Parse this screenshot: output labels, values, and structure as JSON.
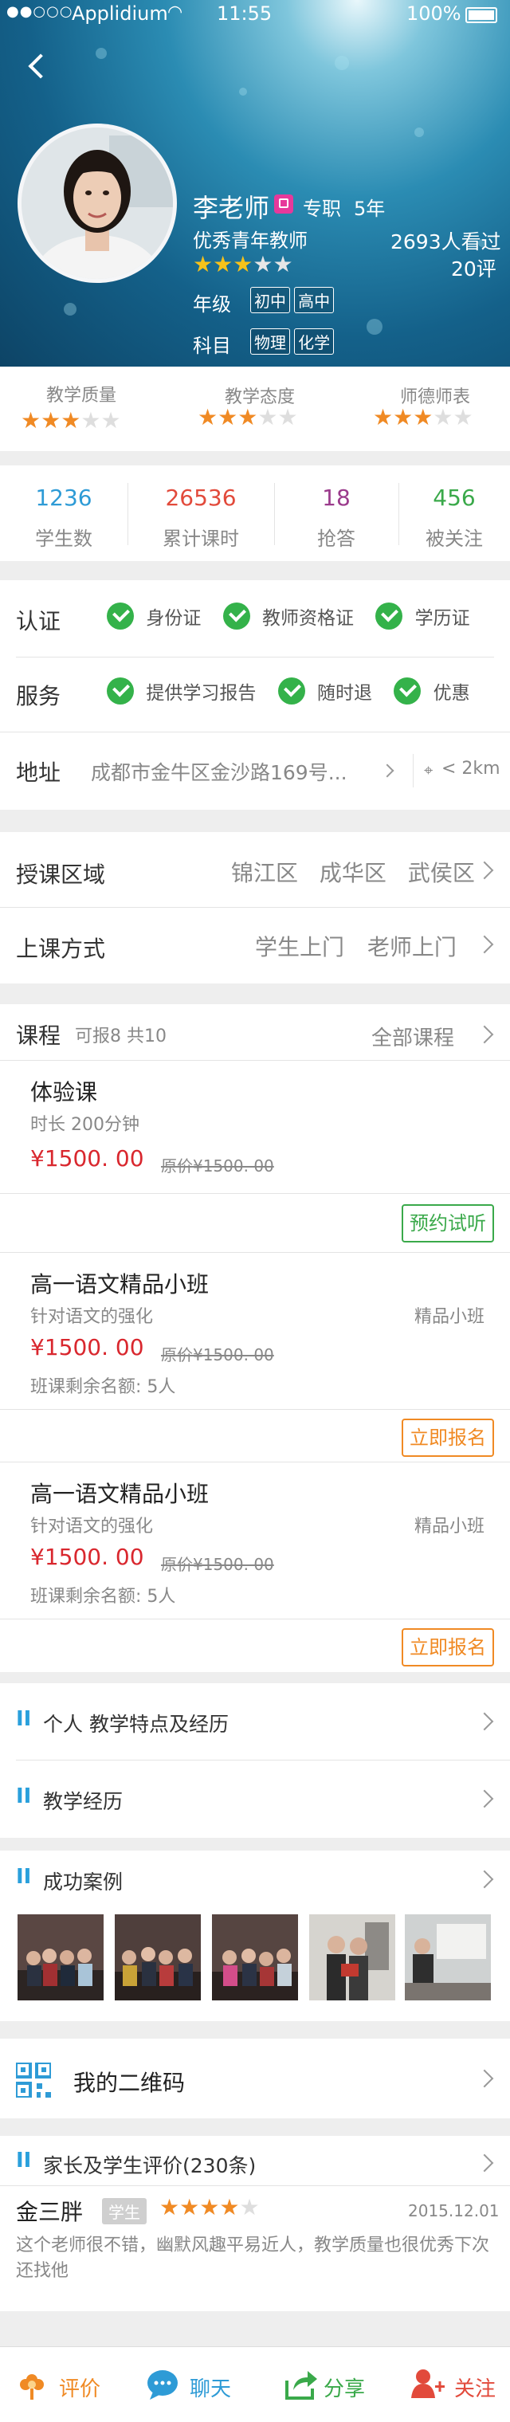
{
  "status_bar": {
    "signal": "●●○○○",
    "carrier": "Applidium",
    "time": "11:55",
    "battery": "100%"
  },
  "teacher": {
    "name": "李老师",
    "type": "专职",
    "years": "5年",
    "title": "优秀青年教师",
    "rating_stars": 3,
    "views": "2693人看过",
    "reviews": "20评",
    "grade_label": "年级",
    "grades": [
      "初中",
      "高中"
    ],
    "subject_label": "科目",
    "subjects": [
      "物理",
      "化学"
    ]
  },
  "ratings": [
    {
      "label": "教学质量",
      "stars": 3
    },
    {
      "label": "教学态度",
      "stars": 3
    },
    {
      "label": "师德师表",
      "stars": 3
    }
  ],
  "stats": [
    {
      "value": "1236",
      "label": "学生数",
      "color": "#2e9bd6"
    },
    {
      "value": "26536",
      "label": "累计课时",
      "color": "#e24a3b"
    },
    {
      "value": "18",
      "label": "抢答",
      "color": "#9b3b8c"
    },
    {
      "value": "456",
      "label": "被关注",
      "color": "#3aa94a"
    }
  ],
  "certs": {
    "label": "认证",
    "items": [
      "身份证",
      "教师资格证",
      "学历证"
    ]
  },
  "services": {
    "label": "服务",
    "items": [
      "提供学习报告",
      "随时退",
      "优惠"
    ]
  },
  "address": {
    "label": "地址",
    "value": "成都市金牛区金沙路169号...",
    "distance": "< 2km"
  },
  "area": {
    "label": "授课区域",
    "items": [
      "锦江区",
      "成华区",
      "武侯区"
    ]
  },
  "mode": {
    "label": "上课方式",
    "items": [
      "学生上门",
      "老师上门"
    ]
  },
  "courses": {
    "label": "课程",
    "count": "可报8 共10",
    "all_label": "全部课程",
    "trial": {
      "name": "体验课",
      "duration": "时长 200分钟",
      "price": "¥1500. 00",
      "orig_price": "原价¥1500. 00",
      "button": "预约试听"
    },
    "classes": [
      {
        "name": "高一语文精品小班",
        "desc": "针对语文的强化",
        "tag": "精品小班",
        "price": "¥1500. 00",
        "orig_price": "原价¥1500. 00",
        "remain": "班课剩余名额: 5人",
        "button": "立即报名"
      },
      {
        "name": "高一语文精品小班",
        "desc": "针对语文的强化",
        "tag": "精品小班",
        "price": "¥1500. 00",
        "orig_price": "原价¥1500. 00",
        "remain": "班课剩余名额: 5人",
        "button": "立即报名"
      }
    ]
  },
  "sections": {
    "features": "个人 教学特点及经历",
    "experience": "教学经历",
    "cases": "成功案例",
    "qrcode": "我的二维码",
    "comments": "家长及学生评价(230条)"
  },
  "comment": {
    "user": "金三胖",
    "role": "学生",
    "stars": 4,
    "date": "2015.12.01",
    "text": "这个老师很不错，幽默风趣平易近人，教学质量也很优秀下次还找他"
  },
  "tabbar": [
    {
      "label": "评价",
      "icon": "flower-icon",
      "color": "#f08a24"
    },
    {
      "label": "聊天",
      "icon": "chat-icon",
      "color": "#2e9bd6"
    },
    {
      "label": "分享",
      "icon": "share-icon",
      "color": "#3aa94a"
    },
    {
      "label": "关注",
      "icon": "add-user-icon",
      "color": "#e24a3b"
    }
  ]
}
